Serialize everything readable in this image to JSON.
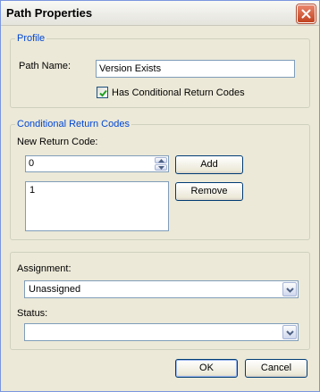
{
  "window": {
    "title": "Path Properties"
  },
  "profile": {
    "group_label": "Profile",
    "path_name_label": "Path Name:",
    "path_name_value": "Version Exists",
    "has_conditional_label": "Has Conditional Return Codes",
    "has_conditional_checked": true
  },
  "conditional": {
    "group_label": "Conditional Return Codes",
    "new_code_label": "New Return Code:",
    "new_code_value": "0",
    "add_label": "Add",
    "remove_label": "Remove",
    "codes": [
      "1"
    ]
  },
  "assignment": {
    "label": "Assignment:",
    "value": "Unassigned",
    "status_label": "Status:",
    "status_value": ""
  },
  "buttons": {
    "ok": "OK",
    "cancel": "Cancel"
  },
  "colors": {
    "group_label": "#0046d5",
    "dialog_bg": "#ece9d8",
    "close_button": "#c1421f"
  },
  "icons": {
    "close": "close-icon",
    "check": "checkmark-icon",
    "spin_up": "arrow-up-icon",
    "spin_down": "arrow-down-icon",
    "dropdown": "chevron-down-icon"
  }
}
